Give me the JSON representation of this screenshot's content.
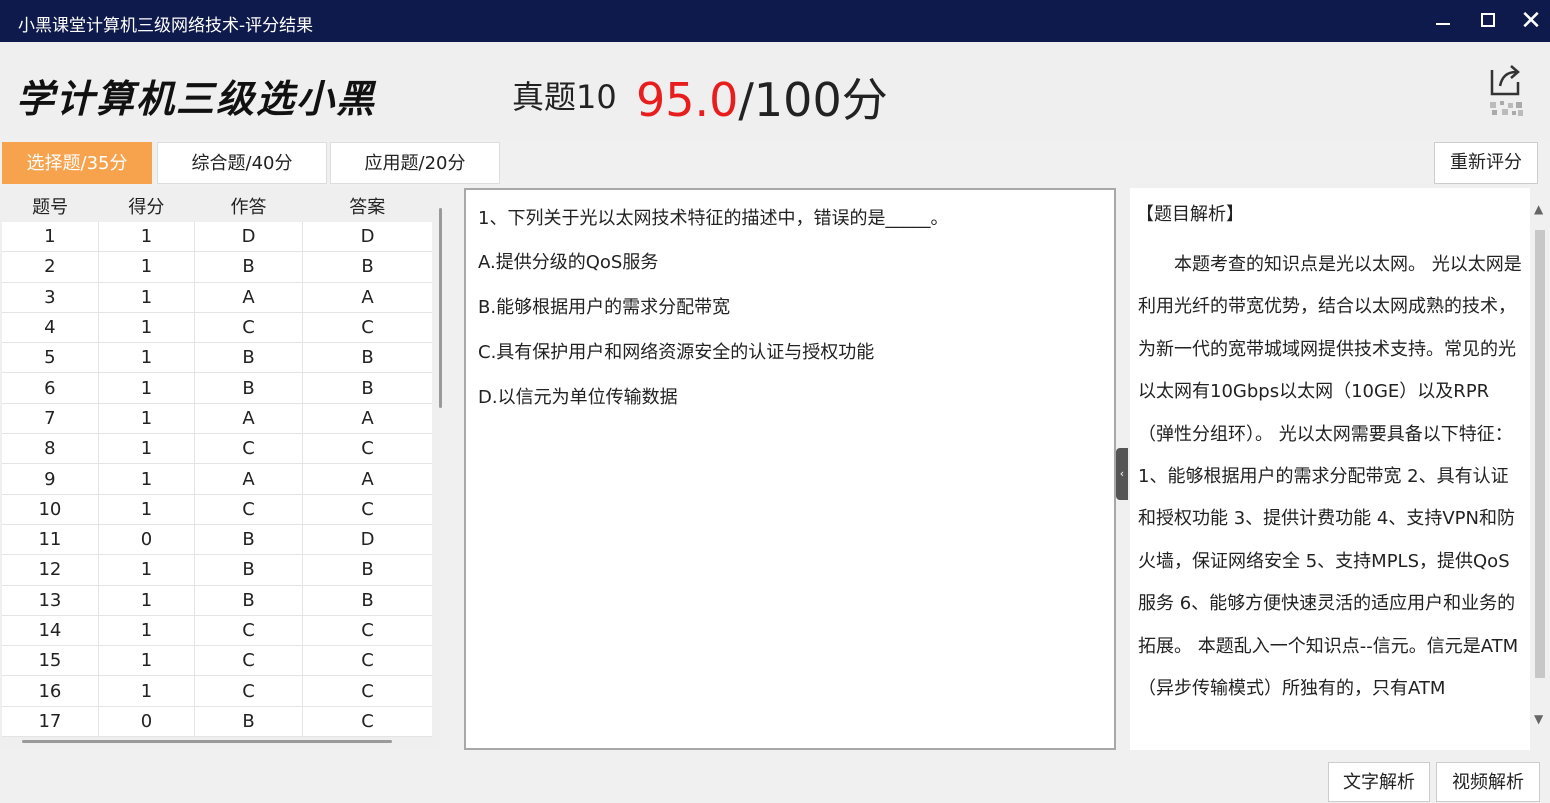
{
  "window": {
    "title": "小黑课堂计算机三级网络技术-评分结果"
  },
  "header": {
    "logo_text": "学计算机三级选小黑",
    "exam_name": "真题10",
    "score": "95.0",
    "score_total": "/100分"
  },
  "tabs": [
    {
      "label": "选择题/35分",
      "active": true
    },
    {
      "label": "综合题/40分",
      "active": false
    },
    {
      "label": "应用题/20分",
      "active": false
    }
  ],
  "rescore_label": "重新评分",
  "table": {
    "headers": [
      "题号",
      "得分",
      "作答",
      "答案"
    ],
    "rows": [
      [
        "1",
        "1",
        "D",
        "D"
      ],
      [
        "2",
        "1",
        "B",
        "B"
      ],
      [
        "3",
        "1",
        "A",
        "A"
      ],
      [
        "4",
        "1",
        "C",
        "C"
      ],
      [
        "5",
        "1",
        "B",
        "B"
      ],
      [
        "6",
        "1",
        "B",
        "B"
      ],
      [
        "7",
        "1",
        "A",
        "A"
      ],
      [
        "8",
        "1",
        "C",
        "C"
      ],
      [
        "9",
        "1",
        "A",
        "A"
      ],
      [
        "10",
        "1",
        "C",
        "C"
      ],
      [
        "11",
        "0",
        "B",
        "D"
      ],
      [
        "12",
        "1",
        "B",
        "B"
      ],
      [
        "13",
        "1",
        "B",
        "B"
      ],
      [
        "14",
        "1",
        "C",
        "C"
      ],
      [
        "15",
        "1",
        "C",
        "C"
      ],
      [
        "16",
        "1",
        "C",
        "C"
      ],
      [
        "17",
        "0",
        "B",
        "C"
      ]
    ]
  },
  "question": {
    "stem": "1、下列关于光以太网技术特征的描述中，错误的是_____。",
    "option_a": "A.提供分级的QoS服务",
    "option_b": "B.能够根据用户的需求分配带宽",
    "option_c": "C.具有保护用户和网络资源安全的认证与授权功能",
    "option_d": "D.以信元为单位传输数据"
  },
  "analysis": {
    "title": "【题目解析】",
    "body": "本题考查的知识点是光以太网。 光以太网是利用光纤的带宽优势，结合以太网成熟的技术，为新一代的宽带城域网提供技术支持。常见的光以太网有10Gbps以太网（10GE）以及RPR（弹性分组环）。 光以太网需要具备以下特征： 1、能够根据用户的需求分配带宽 2、具有认证和授权功能 3、提供计费功能 4、支持VPN和防火墙，保证网络安全 5、支持MPLS，提供QoS服务 6、能够方便快速灵活的适应用户和业务的拓展。 本题乱入一个知识点--信元。信元是ATM（异步传输模式）所独有的，只有ATM"
  },
  "bottom_buttons": {
    "text_analysis": "文字解析",
    "video_analysis": "视频解析"
  },
  "colors": {
    "titlebar": "#0d1a4b",
    "active_tab": "#f7a24d",
    "score": "#e81e1e"
  },
  "icons": {
    "share": "share-export-icon",
    "qr": "qr-code-icon"
  }
}
